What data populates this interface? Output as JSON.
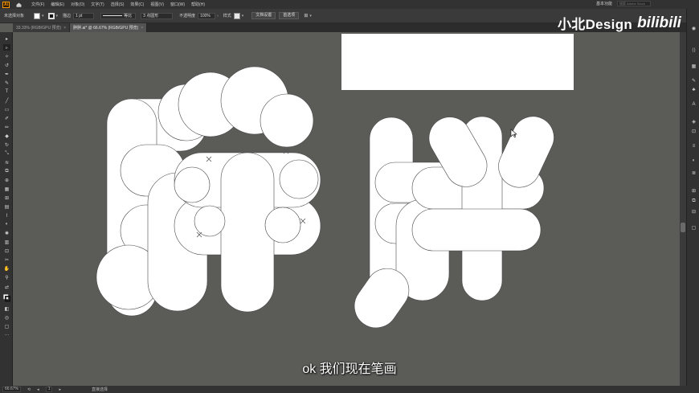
{
  "app": {
    "logo_text": "Ai",
    "menu": [
      "文件(F)",
      "编辑(E)",
      "对象(O)",
      "文字(T)",
      "选择(S)",
      "效果(C)",
      "视图(V)",
      "窗口(W)",
      "帮助(H)"
    ],
    "workspace": "基本功能",
    "search_placeholder": "搜索 Adobe Stock"
  },
  "controlbar": {
    "selection_status": "未选择对象",
    "stroke_label": "描边",
    "stroke_weight": "1 pt",
    "profile_label": "等比",
    "brush_label": "3 点圆形",
    "opacity_label": "不透明度",
    "opacity_value": "100%",
    "style_label": "样式",
    "doc_setup_button": "文档设置",
    "preferences_button": "首选项"
  },
  "tabs": [
    {
      "label": "33.33% (RGB/GPU 预览)"
    },
    {
      "label": "胖胖.ai* @ 66.67% (RGB/GPU 预览)"
    }
  ],
  "watermark": {
    "channel": "小北Design",
    "platform": "bilibili"
  },
  "subtitle": "ok 我们现在笔画",
  "statusbar": {
    "zoom": "66.67%",
    "artboard_num": "1",
    "tool_name": "直接选择"
  },
  "colors": {
    "canvas": "#5b5b58",
    "glyph_fill": "#ffffff",
    "glyph_stroke": "#4a4a4a",
    "accent": "#ff9a00"
  }
}
